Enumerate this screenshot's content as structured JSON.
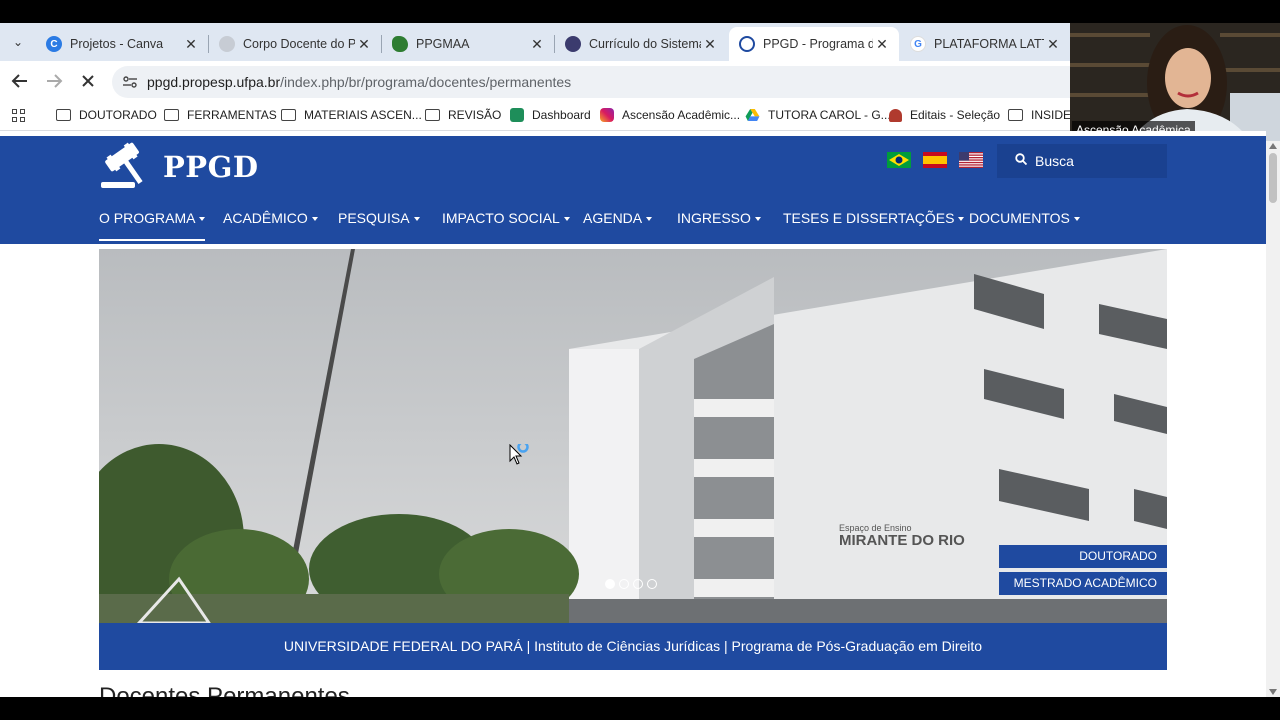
{
  "browser": {
    "tabs": [
      {
        "title": "Projetos - Canva",
        "close": "✕"
      },
      {
        "title": "Corpo Docente do Pr",
        "close": "✕"
      },
      {
        "title": "PPGMAA",
        "close": "✕"
      },
      {
        "title": "Currículo do Sistema",
        "close": "✕"
      },
      {
        "title": "PPGD - Programa de",
        "close": "✕"
      },
      {
        "title": "PLATAFORMA LATTE",
        "close": "✕"
      }
    ],
    "tab_menu_glyph": "⌄",
    "url_host": "ppgd.propesp.ufpa.br",
    "url_path": "/index.php/br/programa/docentes/permanentes",
    "bookmarks": [
      "DOUTORADO",
      "FERRAMENTAS",
      "MATERIAIS ASCEN...",
      "REVISÃO",
      "Dashboard",
      "Ascensão Acadêmic...",
      "TUTORA CAROL - G...",
      "Editais - Seleção",
      "INSIDER"
    ]
  },
  "webcam": {
    "label": "Ascensão Acadêmica"
  },
  "site": {
    "logo_text": "PPGD",
    "search_placeholder": "Busca",
    "menu": [
      "O PROGRAMA",
      "ACADÊMICO",
      "PESQUISA",
      "IMPACTO SOCIAL",
      "AGENDA",
      "INGRESSO",
      "TESES E DISSERTAÇÕES",
      "DOCUMENTOS"
    ],
    "hero_buttons": [
      "DOUTORADO",
      "MESTRADO ACADÊMICO"
    ],
    "building_sign_line1": "Espaço de Ensino",
    "building_sign_line2": "MIRANTE DO RIO",
    "carousel_active_index": 0,
    "caption": "UNIVERSIDADE FEDERAL DO PARÁ | Instituto de Ciências Jurídicas | Programa de Pós-Graduação em Direito",
    "section_title": "Docentes Permanentes"
  },
  "colors": {
    "brand_blue": "#1f4aa0",
    "tabstrip": "#dfe7f2"
  }
}
